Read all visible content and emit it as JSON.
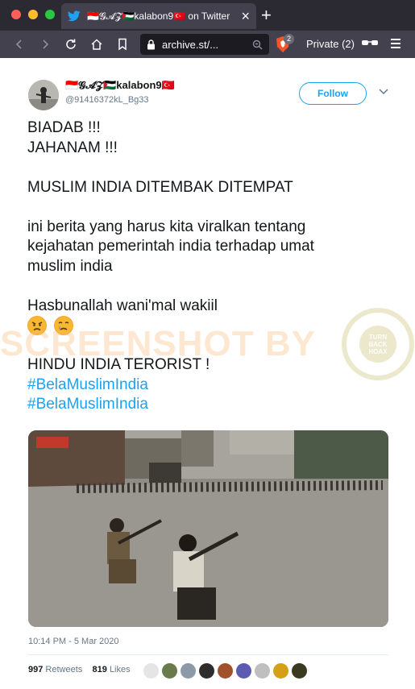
{
  "browser": {
    "tab": {
      "title": "🇮🇩𝓖𝓐𝓩🇵🇸kalabon9🇹🇷 on Twitter",
      "close": "×"
    },
    "new_tab": "+",
    "url": "archive.st/...",
    "shield_count": "2",
    "private_label": "Private (2)",
    "colors": {
      "tab_bg": "#2b2a33",
      "toolbar": "#42414d",
      "url_bg": "#1c1b22"
    }
  },
  "tweet": {
    "display_name": "🇮🇩𝓖𝓐𝓩🇵🇸kalabon9🇹🇷",
    "handle": "@91416372kL_Bg33",
    "follow_label": "Follow",
    "lines": {
      "l1": "BIADAB !!!",
      "l2": "JAHANAM !!!",
      "l3": "MUSLIM INDIA DITEMBAK DITEMPAT",
      "l4": "ini berita yang harus kita viralkan tentang",
      "l5": "kejahatan pemerintah india terhadap umat",
      "l6": "muslim india",
      "l7": "Hasbunallah wani'mal wakiil",
      "l8": "HINDU INDIA TERORIST !"
    },
    "emojis": [
      "angry-face",
      "crying-face"
    ],
    "hashtags": [
      "#BelaMuslimIndia",
      "#BelaMuslimIndia"
    ],
    "timestamp": "10:14 PM - 5 Mar 2020",
    "retweets_count": "997",
    "retweets_label": "Retweets",
    "likes_count": "819",
    "likes_label": "Likes",
    "liker_avatar_count": 9,
    "colors": {
      "link": "#1da1f2",
      "text": "#14171a",
      "muted": "#657786"
    }
  },
  "watermark": {
    "text": "SCREENSHOT BY",
    "stamp_lines": [
      "TURN",
      "BACK",
      "HOAX"
    ]
  }
}
